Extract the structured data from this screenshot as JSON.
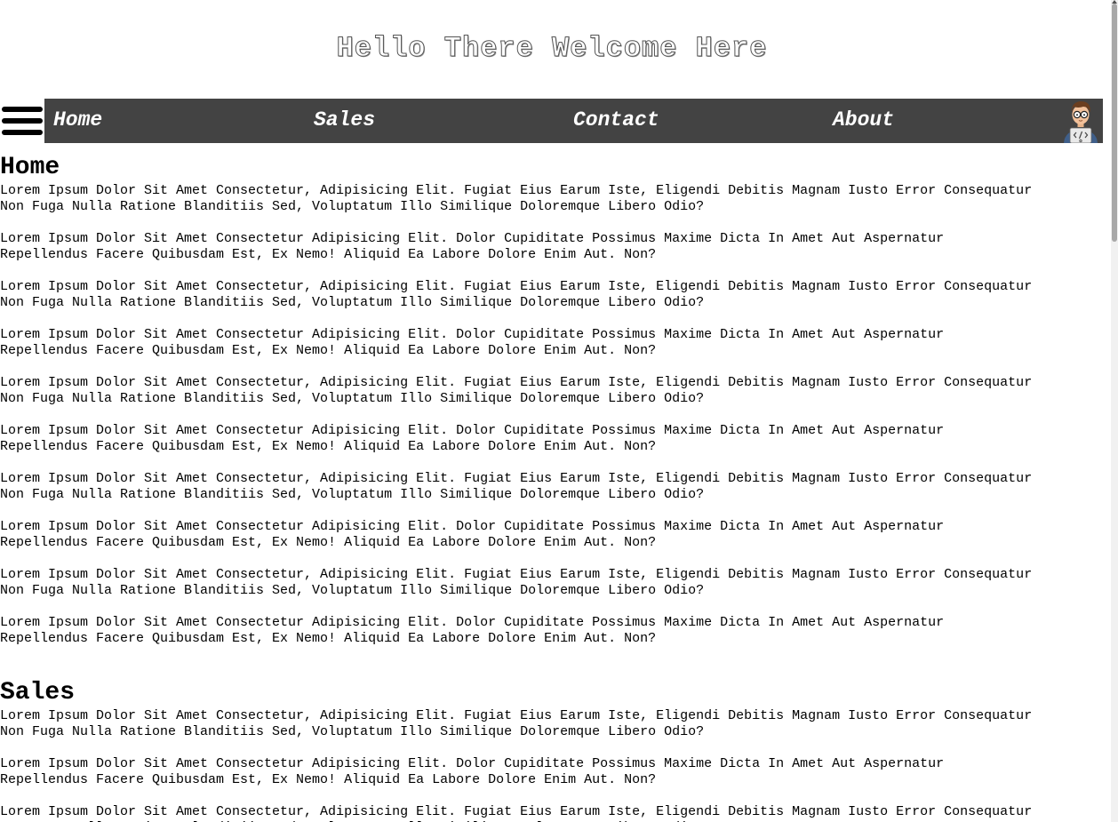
{
  "site": {
    "title": "Hello There Welcome Here"
  },
  "nav": {
    "menu_icon": "hamburger-menu-icon",
    "items": [
      {
        "label": "Home"
      },
      {
        "label": "Sales"
      },
      {
        "label": "Contact"
      },
      {
        "label": "About"
      }
    ],
    "avatar_icon": "developer-avatar-icon"
  },
  "sections": [
    {
      "heading": "Home",
      "paragraphs": [
        "Lorem Ipsum Dolor Sit Amet Consectetur, Adipisicing Elit. Fugiat Eius Earum Iste, Eligendi Debitis Magnam Iusto Error Consequatur\nNon Fuga Nulla Ratione Blanditiis Sed, Voluptatum Illo Similique Doloremque Libero Odio?",
        "Lorem Ipsum Dolor Sit Amet Consectetur Adipisicing Elit. Dolor Cupiditate Possimus Maxime Dicta In Amet Aut Aspernatur\nRepellendus Facere Quibusdam Est, Ex Nemo! Aliquid Ea Labore Dolore Enim Aut. Non?",
        "Lorem Ipsum Dolor Sit Amet Consectetur, Adipisicing Elit. Fugiat Eius Earum Iste, Eligendi Debitis Magnam Iusto Error Consequatur\nNon Fuga Nulla Ratione Blanditiis Sed, Voluptatum Illo Similique Doloremque Libero Odio?",
        "Lorem Ipsum Dolor Sit Amet Consectetur Adipisicing Elit. Dolor Cupiditate Possimus Maxime Dicta In Amet Aut Aspernatur\nRepellendus Facere Quibusdam Est, Ex Nemo! Aliquid Ea Labore Dolore Enim Aut. Non?",
        "Lorem Ipsum Dolor Sit Amet Consectetur, Adipisicing Elit. Fugiat Eius Earum Iste, Eligendi Debitis Magnam Iusto Error Consequatur\nNon Fuga Nulla Ratione Blanditiis Sed, Voluptatum Illo Similique Doloremque Libero Odio?",
        "Lorem Ipsum Dolor Sit Amet Consectetur Adipisicing Elit. Dolor Cupiditate Possimus Maxime Dicta In Amet Aut Aspernatur\nRepellendus Facere Quibusdam Est, Ex Nemo! Aliquid Ea Labore Dolore Enim Aut. Non?",
        "Lorem Ipsum Dolor Sit Amet Consectetur, Adipisicing Elit. Fugiat Eius Earum Iste, Eligendi Debitis Magnam Iusto Error Consequatur\nNon Fuga Nulla Ratione Blanditiis Sed, Voluptatum Illo Similique Doloremque Libero Odio?",
        "Lorem Ipsum Dolor Sit Amet Consectetur Adipisicing Elit. Dolor Cupiditate Possimus Maxime Dicta In Amet Aut Aspernatur\nRepellendus Facere Quibusdam Est, Ex Nemo! Aliquid Ea Labore Dolore Enim Aut. Non?",
        "Lorem Ipsum Dolor Sit Amet Consectetur, Adipisicing Elit. Fugiat Eius Earum Iste, Eligendi Debitis Magnam Iusto Error Consequatur\nNon Fuga Nulla Ratione Blanditiis Sed, Voluptatum Illo Similique Doloremque Libero Odio?",
        "Lorem Ipsum Dolor Sit Amet Consectetur Adipisicing Elit. Dolor Cupiditate Possimus Maxime Dicta In Amet Aut Aspernatur\nRepellendus Facere Quibusdam Est, Ex Nemo! Aliquid Ea Labore Dolore Enim Aut. Non?"
      ]
    },
    {
      "heading": "Sales",
      "paragraphs": [
        "Lorem Ipsum Dolor Sit Amet Consectetur, Adipisicing Elit. Fugiat Eius Earum Iste, Eligendi Debitis Magnam Iusto Error Consequatur\nNon Fuga Nulla Ratione Blanditiis Sed, Voluptatum Illo Similique Doloremque Libero Odio?",
        "Lorem Ipsum Dolor Sit Amet Consectetur Adipisicing Elit. Dolor Cupiditate Possimus Maxime Dicta In Amet Aut Aspernatur\nRepellendus Facere Quibusdam Est, Ex Nemo! Aliquid Ea Labore Dolore Enim Aut. Non?",
        "Lorem Ipsum Dolor Sit Amet Consectetur, Adipisicing Elit. Fugiat Eius Earum Iste, Eligendi Debitis Magnam Iusto Error Consequatur\nNon Fuga Nulla Ratione Blanditiis Sed, Voluptatum Illo Similique Doloremque Libero Odio?"
      ]
    }
  ],
  "colors": {
    "navbar_bg": "#434343",
    "nav_text": "#ffffff",
    "body_text": "#000000"
  }
}
